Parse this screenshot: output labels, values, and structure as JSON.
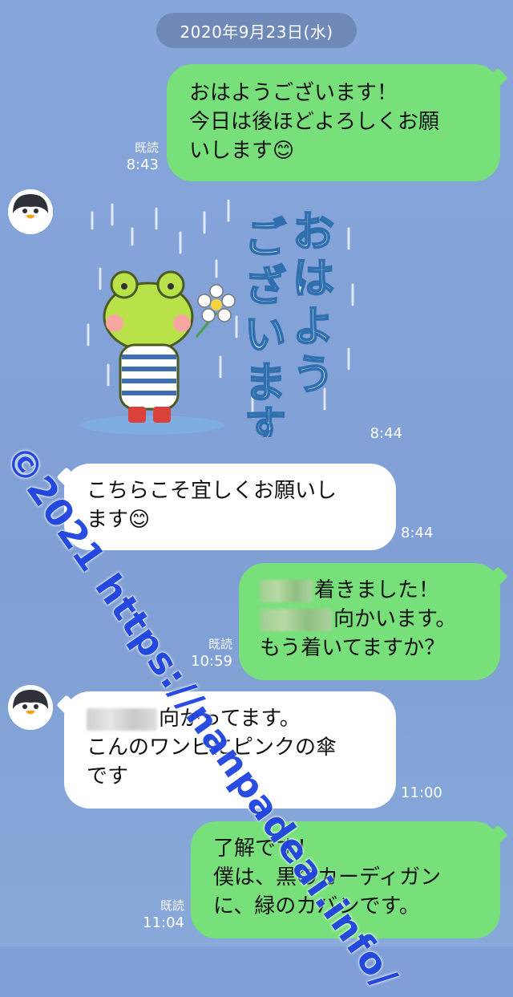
{
  "date_label": "2020年9月23日(水)",
  "read_label": "既読",
  "messages": [
    {
      "side": "sent",
      "lines": [
        "おはようございます！",
        "今日は後ほどよろしくお願",
        "いします😊"
      ],
      "read": "既読",
      "time": "8:43"
    },
    {
      "side": "recv",
      "type": "sticker",
      "sticker_text": "おはようございます",
      "time": "8:44"
    },
    {
      "side": "recv",
      "lines": [
        "こちらこそ宜しくお願いし",
        "ます😊"
      ],
      "time": "8:44"
    },
    {
      "side": "sent",
      "lines": [
        "着きました！",
        "向かいます。",
        "もう着いてますか？"
      ],
      "read": "既読",
      "time": "10:59"
    },
    {
      "side": "recv",
      "lines": [
        "向かってます。",
        "こんのワンピにピンクの傘",
        "です"
      ],
      "time": "11:00"
    },
    {
      "side": "sent",
      "lines": [
        "了解です！",
        "僕は、黒のカーディガン",
        "に、緑のカバンです。"
      ],
      "read": "既読",
      "time": "11:04"
    }
  ],
  "watermark": "©2021 https://nanpadeai.info/",
  "colors": {
    "sent_bubble": "#78e07a",
    "recv_bubble": "#ffffff",
    "background": "#7f9fd6",
    "date_pill": "#6f89b8",
    "watermark": "#1f44e0"
  },
  "icons": {
    "avatar": "penguin-icon",
    "sticker": "frog-sticker"
  }
}
